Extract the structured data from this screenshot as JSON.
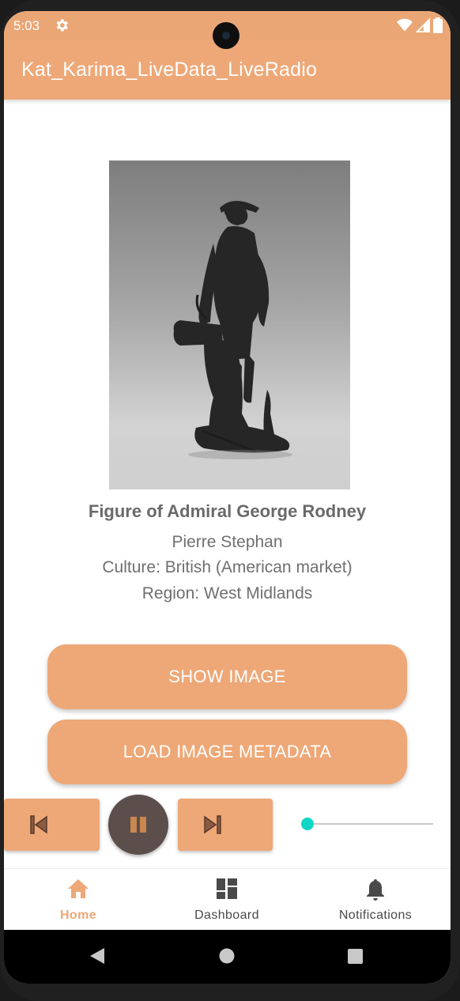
{
  "status_bar": {
    "time": "5:03",
    "icons": [
      "gear-icon",
      "wifi-icon",
      "signal-icon",
      "battery-icon"
    ]
  },
  "app_bar": {
    "title": "Kat_Karima_LiveData_LiveRadio"
  },
  "artwork": {
    "title": "Figure of Admiral George Rodney",
    "artist": "Pierre Stephan",
    "culture": "Culture: British (American market)",
    "region": "Region: West Midlands"
  },
  "buttons": {
    "show_image": "SHOW IMAGE",
    "load_metadata": "LOAD IMAGE METADATA"
  },
  "player": {
    "icons": [
      "skip-previous-icon",
      "pause-icon",
      "skip-next-icon"
    ],
    "seek_position": 0
  },
  "bottom_nav": {
    "items": [
      {
        "label": "Home",
        "icon": "home-icon",
        "active": true
      },
      {
        "label": "Dashboard",
        "icon": "dashboard-icon",
        "active": false
      },
      {
        "label": "Notifications",
        "icon": "bell-icon",
        "active": false
      }
    ]
  },
  "colors": {
    "accent": "#eea777",
    "active_nav": "#eea777",
    "inactive_nav": "#4a4a4a",
    "slider": "#10d6c6",
    "pause_button": "#5b4e4b"
  }
}
